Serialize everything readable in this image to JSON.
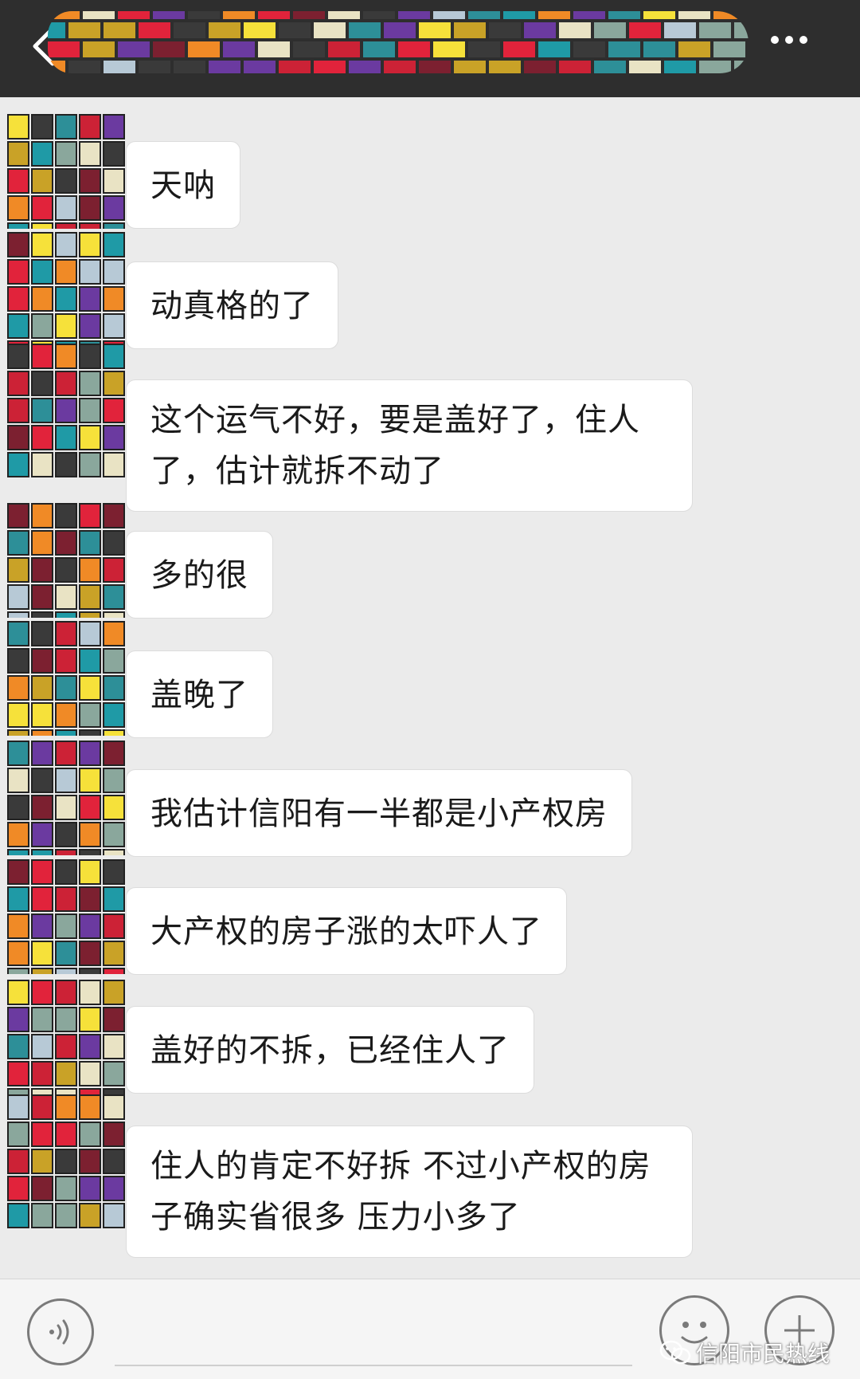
{
  "header": {
    "title_obscured": true
  },
  "messages": [
    {
      "text": "天呐"
    },
    {
      "text": "动真格的了"
    },
    {
      "text": "这个运气不好，要是盖好了，住人了，估计就拆不动了"
    },
    {
      "text": "多的很"
    },
    {
      "text": "盖晚了"
    },
    {
      "text": "我估计信阳有一半都是小产权房"
    },
    {
      "text": "大产权的房子涨的太吓人了"
    },
    {
      "text": "盖好的不拆，已经住人了"
    },
    {
      "text": "住人的肯定不好拆 不过小产权的房子确实省很多 压力小多了"
    }
  ],
  "watermark": {
    "text": "信阳市民热线"
  },
  "colors": {
    "topbar": "#2e2e2e",
    "background": "#ebebeb",
    "bubble": "#ffffff"
  }
}
